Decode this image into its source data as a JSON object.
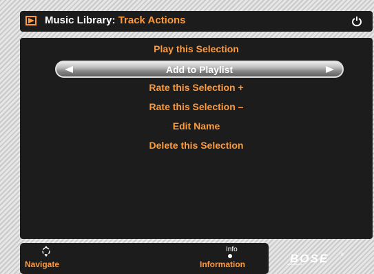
{
  "header": {
    "title_prefix": "Music Library:",
    "title_accent": "Track Actions",
    "icons": [
      "play-box-icon",
      "power-icon"
    ]
  },
  "menu": {
    "items": [
      {
        "label": "Play this Selection",
        "selected": false
      },
      {
        "label": "Add to Playlist",
        "selected": true
      },
      {
        "label": "Rate this Selection +",
        "selected": false
      },
      {
        "label": "Rate this Selection –",
        "selected": false
      },
      {
        "label": "Edit Name",
        "selected": false
      },
      {
        "label": "Delete this Selection",
        "selected": false
      }
    ]
  },
  "footer": {
    "navigate_label": "Navigate",
    "info_small": "Info",
    "info_label": "Information"
  },
  "brand": "BOSE",
  "colors": {
    "accent": "#ff9a3c",
    "panel": "#1c1c1c",
    "text": "#ffffff"
  }
}
